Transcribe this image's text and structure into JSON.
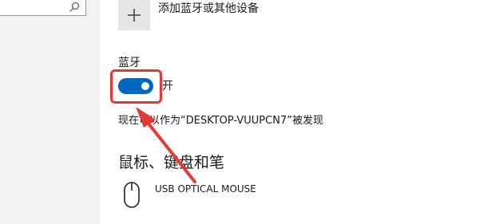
{
  "add_device": {
    "label": "添加蓝牙或其他设备",
    "icon": "plus-icon"
  },
  "bluetooth": {
    "heading": "蓝牙",
    "toggle_on": true,
    "toggle_state_label": "开",
    "discoverable_text": "现在可以作为“DESKTOP-VUUPCN7”被发现"
  },
  "mouse_section": {
    "heading": "鼠标、键盘和笔",
    "devices": [
      {
        "name": "USB OPTICAL MOUSE",
        "icon": "mouse-icon"
      }
    ]
  },
  "colors": {
    "toggle_on": "#0067c0",
    "annotation": "#e53935",
    "sidebar": "#f2f2f2"
  }
}
